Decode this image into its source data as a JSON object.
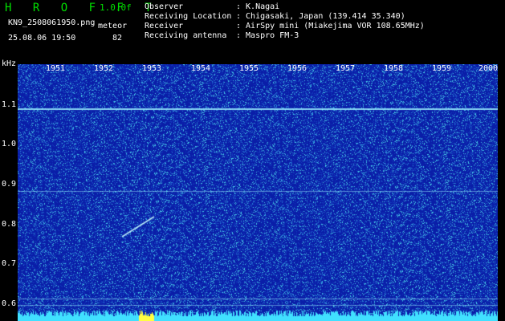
{
  "header": {
    "title": "H R O F F T",
    "version": "1.0.0f",
    "filename": "KN9_2508061950.png",
    "meteor_label": "meteor",
    "timestamp": "25.08.06 19:50",
    "meteor_count": "82"
  },
  "info": [
    {
      "key": "Observer",
      "value": ": K.Nagai"
    },
    {
      "key": "Receiving Location",
      "value": ": Chigasaki, Japan (139.414 35.340)"
    },
    {
      "key": "Receiver",
      "value": ": AirSpy mini (Miakejima VOR 108.65MHz)"
    },
    {
      "key": "Receiving antenna",
      "value": ": Maspro FM-3"
    }
  ],
  "axis": {
    "unit": "kHz",
    "y_labels": [
      "1.1",
      "1.0",
      "0.9",
      "0.8",
      "0.7",
      "0.6"
    ],
    "time_labels": [
      "1951",
      "1952",
      "1953",
      "1954",
      "1955",
      "1956",
      "1957",
      "1958",
      "1959",
      "2000"
    ]
  },
  "colors": {
    "background": "#0a1fa8",
    "noise_cyan": "#4fd8e8",
    "signal": "#9cf0ff",
    "title_green": "#00e000"
  }
}
